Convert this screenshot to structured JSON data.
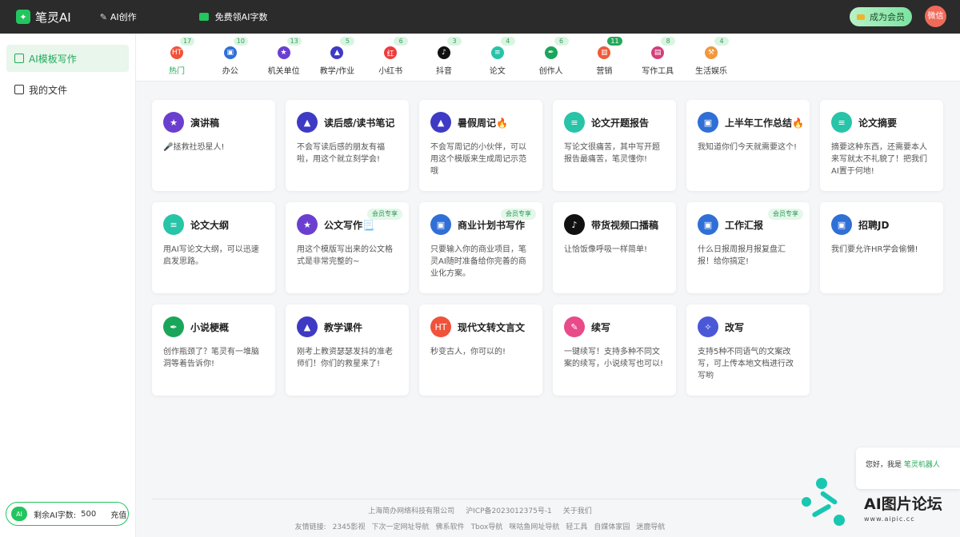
{
  "header": {
    "logo_text": "笔灵AI",
    "nav_ai": "AI创作",
    "nav_free": "免费领AI字数",
    "vip_button": "成为会员",
    "avatar_text": "微信"
  },
  "sidebar": {
    "items": [
      {
        "label": "AI模板写作",
        "active": true
      },
      {
        "label": "我的文件",
        "active": false
      }
    ],
    "footer": {
      "badge": "AI",
      "remain_label": "剩余AI字数:",
      "remain_value": "500",
      "recharge": "充值"
    }
  },
  "tabs": [
    {
      "label": "热门",
      "badge": "17",
      "active": true,
      "icon": "fire-icon",
      "color": "#f0533a"
    },
    {
      "label": "办公",
      "badge": "10",
      "active": false,
      "icon": "briefcase-icon",
      "color": "#2f6fd6"
    },
    {
      "label": "机关单位",
      "badge": "13",
      "active": false,
      "icon": "star-badge-icon",
      "color": "#6a3fd0"
    },
    {
      "label": "教学/作业",
      "badge": "5",
      "active": false,
      "icon": "graduation-cap-icon",
      "color": "#3f3ac4"
    },
    {
      "label": "小红书",
      "badge": "6",
      "active": false,
      "icon": "xiaohongshu-icon",
      "color": "#ef3b3b"
    },
    {
      "label": "抖音",
      "badge": "3",
      "active": false,
      "icon": "tiktok-icon",
      "color": "#111111"
    },
    {
      "label": "论文",
      "badge": "4",
      "active": false,
      "icon": "document-icon",
      "color": "#27c4a8"
    },
    {
      "label": "创作人",
      "badge": "6",
      "active": false,
      "icon": "pen-nib-icon",
      "color": "#1aa65a"
    },
    {
      "label": "营销",
      "badge": "11",
      "active": false,
      "badge_dark": true,
      "icon": "chart-icon",
      "color": "#ef5a3a"
    },
    {
      "label": "写作工具",
      "badge": "8",
      "active": false,
      "icon": "bookmark-icon",
      "color": "#d63e7a"
    },
    {
      "label": "生活娱乐",
      "badge": "4",
      "active": false,
      "icon": "hammer-icon",
      "color": "#f2973a"
    }
  ],
  "cards": [
    {
      "title": "演讲稿",
      "desc": "🎤拯救社恐星人!",
      "icon": "star-badge-icon",
      "color": "#6a3fd0",
      "vip": ""
    },
    {
      "title": "读后感/读书笔记",
      "desc": "不会写读后感的朋友有福啦，用这个就立刻学会!",
      "icon": "graduation-cap-icon",
      "color": "#3f3ac4",
      "vip": ""
    },
    {
      "title": "暑假周记🔥",
      "desc": "不会写周记的小伙伴，可以用这个模版来生成周记示范哦",
      "icon": "graduation-cap-icon",
      "color": "#3f3ac4",
      "vip": ""
    },
    {
      "title": "论文开题报告",
      "desc": "写论文很痛苦，其中写开题报告最痛苦，笔灵懂你!",
      "icon": "document-icon",
      "color": "#27c4a8",
      "vip": ""
    },
    {
      "title": "上半年工作总结🔥",
      "desc": "我知道你们今天就需要这个!",
      "icon": "briefcase-icon",
      "color": "#2f6fd6",
      "vip": ""
    },
    {
      "title": "论文摘要",
      "desc": "摘要这种东西，还需要本人来写就太不礼貌了！把我们AI置于何地!",
      "icon": "document-icon",
      "color": "#27c4a8",
      "vip": ""
    },
    {
      "title": "论文大纲",
      "desc": "用AI写论文大纲，可以迅速启发思路。",
      "icon": "document-icon",
      "color": "#27c4a8",
      "vip": ""
    },
    {
      "title": "公文写作📃",
      "desc": "用这个模版写出来的公文格式是非常完整的~",
      "icon": "star-badge-icon",
      "color": "#6a3fd0",
      "vip": "会员专享"
    },
    {
      "title": "商业计划书写作",
      "desc": "只要输入你的商业项目，笔灵AI随时准备给你完善的商业化方案。",
      "icon": "briefcase-icon",
      "color": "#2f6fd6",
      "vip": "会员专享"
    },
    {
      "title": "带货视频口播稿",
      "desc": "让恰饭像呼吸一样简单!",
      "icon": "tiktok-icon",
      "color": "#111111",
      "vip": ""
    },
    {
      "title": "工作汇报",
      "desc": "什么日报周报月报复盘汇报！给你搞定!",
      "icon": "briefcase-icon",
      "color": "#2f6fd6",
      "vip": "会员专享"
    },
    {
      "title": "招聘JD",
      "desc": "我们要允许HR学会偷懒!",
      "icon": "briefcase-icon",
      "color": "#2f6fd6",
      "vip": ""
    },
    {
      "title": "小说梗概",
      "desc": "创作瓶颈了？笔灵有一堆脑洞等着告诉你!",
      "icon": "pen-nib-icon",
      "color": "#1aa65a",
      "vip": ""
    },
    {
      "title": "教学课件",
      "desc": "刚考上教资瑟瑟发抖的准老师们！你们的救星来了!",
      "icon": "graduation-cap-icon",
      "color": "#3f3ac4",
      "vip": ""
    },
    {
      "title": "现代文转文言文",
      "desc": "秒变古人，你可以的!",
      "icon": "fire-icon",
      "color": "#f0533a",
      "vip": ""
    },
    {
      "title": "续写",
      "desc": "一键续写！支持多种不同文案的续写，小说续写也可以!",
      "icon": "pencil-icon",
      "color": "#e84a8a",
      "vip": ""
    },
    {
      "title": "改写",
      "desc": "支持5种不同语气的文案改写，可上传本地文档进行改写哟",
      "icon": "magic-wand-icon",
      "color": "#4a58d8",
      "vip": ""
    }
  ],
  "footer": {
    "company": "上海简办网络科技有限公司",
    "icp": "沪ICP备2023012375号-1",
    "about": "关于我们",
    "links_label": "友情链接:",
    "links": [
      "2345影视",
      "下次一定网址导航",
      "佛系软件",
      "Tbox导航",
      "咪咕鱼网址导航",
      "轻工具",
      "自媒体家园",
      "迷鹿导航"
    ]
  },
  "chat": {
    "greeting": "您好，我是",
    "bot_name": "笔灵机器人"
  },
  "watermark": {
    "text": "AI图片论坛",
    "url": "www.aipic.cc"
  }
}
